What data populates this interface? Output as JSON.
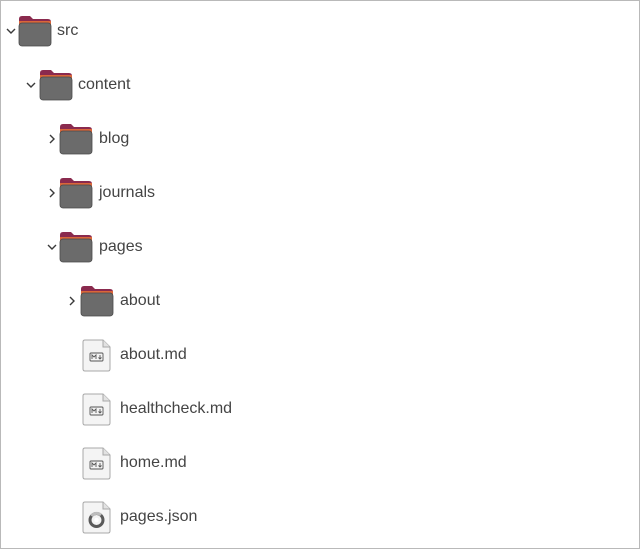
{
  "tree": {
    "src": {
      "label": "src",
      "icon": "folder-icon",
      "state": "expanded"
    },
    "content": {
      "label": "content",
      "icon": "folder-icon",
      "state": "expanded"
    },
    "blog": {
      "label": "blog",
      "icon": "folder-icon",
      "state": "collapsed"
    },
    "journals": {
      "label": "journals",
      "icon": "folder-icon",
      "state": "collapsed"
    },
    "pages": {
      "label": "pages",
      "icon": "folder-icon",
      "state": "expanded"
    },
    "about_folder": {
      "label": "about",
      "icon": "folder-icon",
      "state": "collapsed"
    },
    "about_md": {
      "label": "about.md",
      "icon": "markdown-file-icon"
    },
    "healthcheck_md": {
      "label": "healthcheck.md",
      "icon": "markdown-file-icon"
    },
    "home_md": {
      "label": "home.md",
      "icon": "markdown-file-icon"
    },
    "pages_json": {
      "label": "pages.json",
      "icon": "json-file-icon"
    }
  },
  "colors": {
    "folder_body": "#6b6b6b",
    "folder_tab": "#8a2a4e",
    "folder_stripe": "#d9663a",
    "file_paper": "#f4f4f4",
    "label_text": "#444444",
    "border": "#b9b9b9"
  }
}
